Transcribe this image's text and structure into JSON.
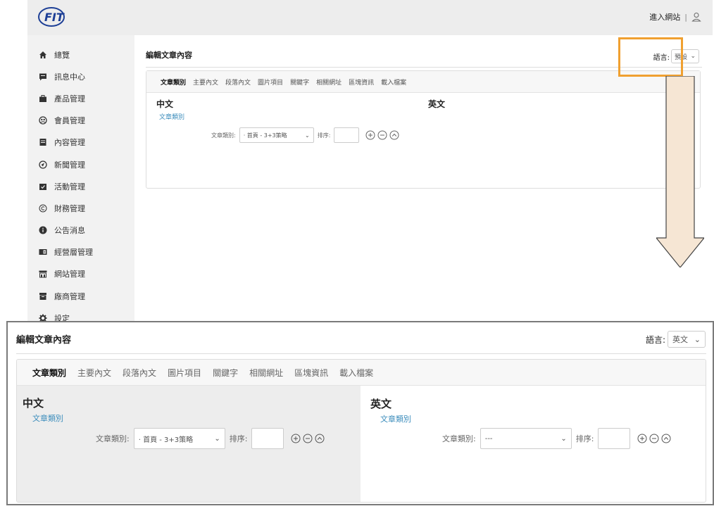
{
  "top": {
    "header": {
      "enter_site": "進入網站",
      "separator": "|"
    },
    "sidebar": {
      "items": [
        {
          "icon": "home-icon",
          "label": "總覽"
        },
        {
          "icon": "message-icon",
          "label": "訊息中心"
        },
        {
          "icon": "briefcase-icon",
          "label": "產品管理"
        },
        {
          "icon": "members-icon",
          "label": "會員管理"
        },
        {
          "icon": "document-icon",
          "label": "內容管理"
        },
        {
          "icon": "news-icon",
          "label": "新聞管理"
        },
        {
          "icon": "calendar-check-icon",
          "label": "活動管理"
        },
        {
          "icon": "copyright-icon",
          "label": "財務管理"
        },
        {
          "icon": "info-icon",
          "label": "公告消息"
        },
        {
          "icon": "id-card-icon",
          "label": "經營層管理"
        },
        {
          "icon": "website-icon",
          "label": "網站管理"
        },
        {
          "icon": "archive-icon",
          "label": "廠商管理"
        },
        {
          "icon": "gear-icon",
          "label": "設定"
        }
      ]
    },
    "page_title": "編輯文章內容",
    "language_label": "語言:",
    "language_value": "預設",
    "tabs": [
      "文章類別",
      "主要內文",
      "段落內文",
      "圖片項目",
      "關鍵字",
      "相關網址",
      "區塊資訊",
      "載入檔案"
    ],
    "zh_heading": "中文",
    "zh_link": "文章類別",
    "en_heading": "英文",
    "field_label": "文章類別:",
    "field_value": "· 首頁 - 3+3策略",
    "sort_label": "排序:"
  },
  "bottom": {
    "page_title": "編輯文章內容",
    "language_label": "語言:",
    "language_value": "英文",
    "tabs": [
      "文章類別",
      "主要內文",
      "段落內文",
      "圖片項目",
      "關鍵字",
      "相關網址",
      "區塊資訊",
      "載入檔案"
    ],
    "zh_heading": "中文",
    "zh_link": "文章類別",
    "zh_field_label": "文章類別:",
    "zh_field_value": "· 首頁 - 3+3策略",
    "sort_label": "排序:",
    "en_heading": "英文",
    "en_link": "文章類別",
    "en_field_label": "文章類別:",
    "en_field_value": "---"
  },
  "colors": {
    "highlight": "#f0a030",
    "arrow_fill": "#f6e6d4",
    "link": "#3c8dbc"
  }
}
